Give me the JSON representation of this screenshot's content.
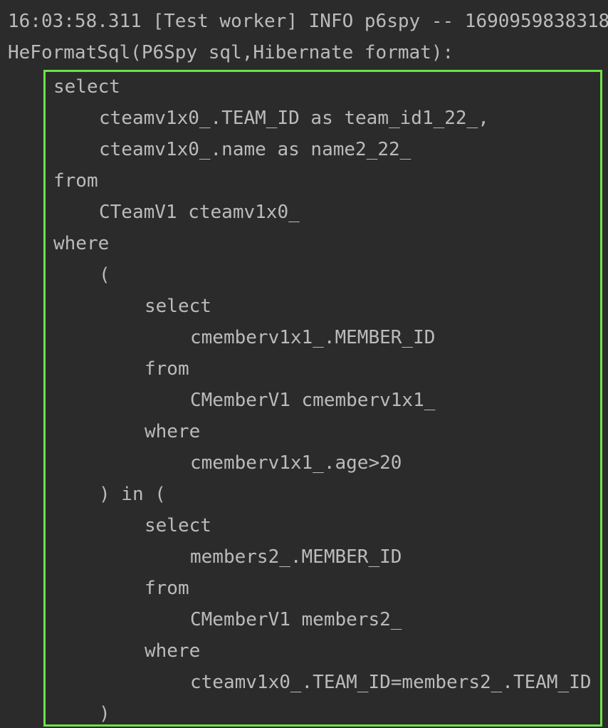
{
  "console": {
    "header": [
      "16:03:58.311 [Test worker] INFO p6spy -- 1690959838318",
      "HeFormatSql(P6Spy sql,Hibernate format):"
    ],
    "sql_lines": [
      {
        "indent": 0,
        "text": "select"
      },
      {
        "indent": 1,
        "text": "cteamv1x0_.TEAM_ID as team_id1_22_,"
      },
      {
        "indent": 1,
        "text": "cteamv1x0_.name as name2_22_"
      },
      {
        "indent": 0,
        "text": "from"
      },
      {
        "indent": 1,
        "text": "CTeamV1 cteamv1x0_"
      },
      {
        "indent": 0,
        "text": "where"
      },
      {
        "indent": 1,
        "text": "("
      },
      {
        "indent": 2,
        "text": "select"
      },
      {
        "indent": 3,
        "text": "cmemberv1x1_.MEMBER_ID"
      },
      {
        "indent": 2,
        "text": "from"
      },
      {
        "indent": 3,
        "text": "CMemberV1 cmemberv1x1_"
      },
      {
        "indent": 2,
        "text": "where"
      },
      {
        "indent": 3,
        "text": "cmemberv1x1_.age>20"
      },
      {
        "indent": 1,
        "text": ") in ("
      },
      {
        "indent": 2,
        "text": "select"
      },
      {
        "indent": 3,
        "text": "members2_.MEMBER_ID"
      },
      {
        "indent": 2,
        "text": "from"
      },
      {
        "indent": 3,
        "text": "CMemberV1 members2_"
      },
      {
        "indent": 2,
        "text": "where"
      },
      {
        "indent": 3,
        "text": "cteamv1x0_.TEAM_ID=members2_.TEAM_ID"
      },
      {
        "indent": 1,
        "text": ")"
      }
    ]
  },
  "colors": {
    "background": "#2b2b2b",
    "text": "#bbbbbb",
    "highlight_border": "#6be347"
  }
}
